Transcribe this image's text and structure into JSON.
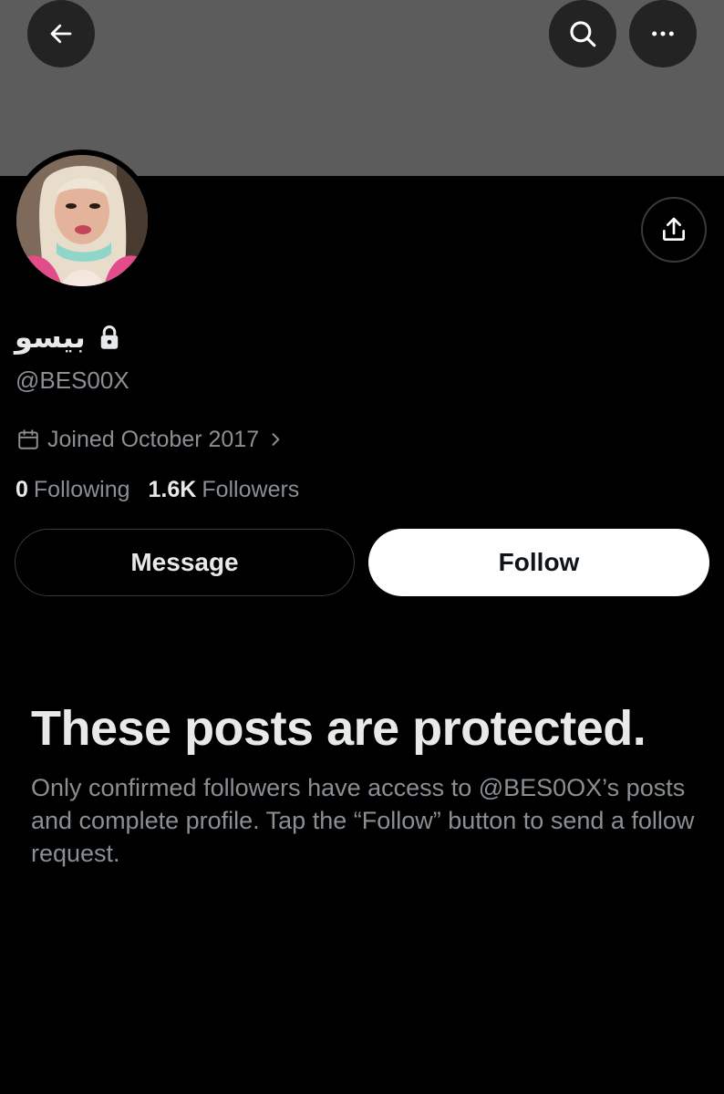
{
  "header": {
    "back_icon": "arrow-left-icon",
    "search_icon": "search-icon",
    "more_icon": "more-horizontal-icon"
  },
  "profile": {
    "display_name": "بيسو",
    "lock_icon": "lock-icon",
    "handle": "@BES00X",
    "joined": "Joined October 2017",
    "calendar_icon": "calendar-icon",
    "following_count": "0",
    "following_label": "Following",
    "followers_count": "1.6K",
    "followers_label": "Followers"
  },
  "actions": {
    "message_label": "Message",
    "follow_label": "Follow",
    "share_icon": "share-icon"
  },
  "protected": {
    "title": "These posts are protected.",
    "description": "Only confirmed followers have access to @BES0OX’s posts and complete profile. Tap the “Follow” button to send a follow request."
  },
  "colors": {
    "background": "#000000",
    "banner": "#5c5c5c",
    "primary_text": "#e7e9ea",
    "secondary_text": "#8a8f94",
    "follow_button_bg": "#ffffff"
  }
}
